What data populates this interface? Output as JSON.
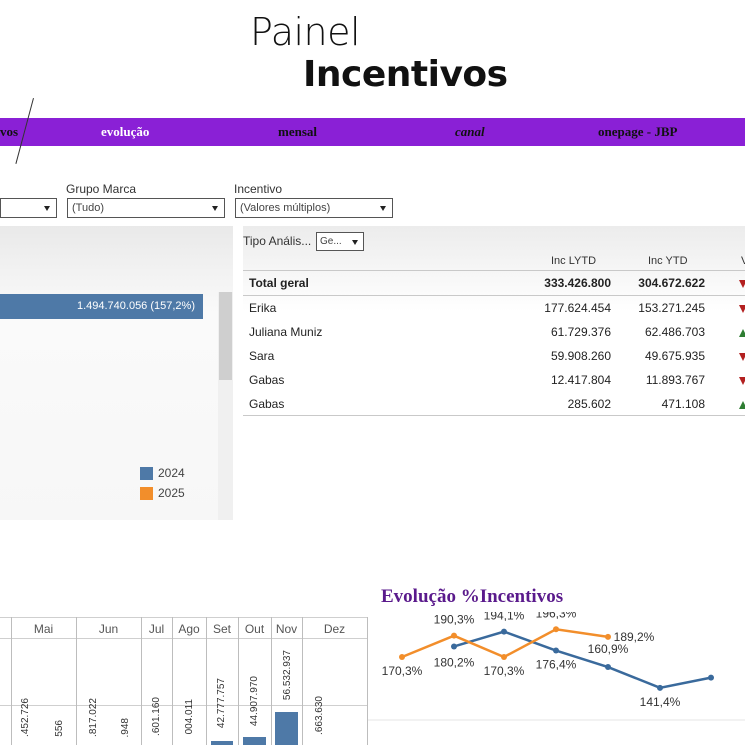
{
  "header": {
    "title_line1": "Painel",
    "title_line2": "Incentivos"
  },
  "nav": {
    "items": [
      {
        "label": "vos"
      },
      {
        "label": "evolução"
      },
      {
        "label": "mensal"
      },
      {
        "label": "canal"
      },
      {
        "label": "onepage - JBP"
      }
    ]
  },
  "filters": {
    "grupo_marca": {
      "label": "Grupo Marca",
      "value": "(Tudo)"
    },
    "incentivo": {
      "label": "Incentivo",
      "value": "(Valores múltiplos)"
    }
  },
  "left_panel": {
    "bar_label": "1.494.740.056 (157,2%)",
    "legend": [
      {
        "label": "2024",
        "color": "#4e79a7"
      },
      {
        "label": "2025",
        "color": "#f28e2b"
      }
    ]
  },
  "table": {
    "tipo_label": "Tipo Anális...",
    "tipo_value": "Ge...",
    "columns": [
      "Inc LYTD",
      "Inc YTD",
      "V"
    ],
    "total": {
      "name": "Total geral",
      "lytd": "333.426.800",
      "ytd": "304.672.622"
    },
    "rows": [
      {
        "name": "Erika",
        "lytd": "177.624.454",
        "ytd": "153.271.245",
        "trend": "down"
      },
      {
        "name": "Juliana Muniz",
        "lytd": "61.729.376",
        "ytd": "62.486.703",
        "trend": "up"
      },
      {
        "name": "Sara",
        "lytd": "59.908.260",
        "ytd": "49.675.935",
        "trend": "down"
      },
      {
        "name": "Gabas",
        "lytd": "12.417.804",
        "ytd": "11.893.767",
        "trend": "down"
      },
      {
        "name": "Gabas",
        "lytd": "285.602",
        "ytd": "471.108",
        "trend": "up"
      }
    ]
  },
  "monthly": {
    "months": [
      "Mai",
      "Jun",
      "Jul",
      "Ago",
      "Set",
      "Out",
      "Nov",
      "Dez"
    ],
    "values": [
      {
        "month": "Mai",
        "labels": [
          ".452.726",
          "556"
        ]
      },
      {
        "month": "Jun",
        "labels": [
          ".817.022",
          ".948"
        ]
      },
      {
        "month": "Jul",
        "labels": [
          ".601.160"
        ]
      },
      {
        "month": "Ago",
        "labels": [
          "004.011"
        ]
      },
      {
        "month": "Set",
        "labels": [
          "42.777.757"
        ]
      },
      {
        "month": "Out",
        "labels": [
          "44.907.970"
        ]
      },
      {
        "month": "Nov",
        "labels": [
          "56.532.937"
        ]
      },
      {
        "month": "Dez",
        "labels": [
          ".663.630"
        ]
      }
    ]
  },
  "evolucao": {
    "title": "Evolução %Incentivos",
    "chart_data": {
      "type": "line",
      "series": [
        {
          "name": "2024",
          "color": "#3a6a9c",
          "values": [
            null,
            180.2,
            194.1,
            176.4,
            160.9,
            141.4,
            151.0
          ],
          "labels": [
            "",
            "180,2%",
            "194,1%",
            "176,4%",
            "160,9%",
            "141,4%",
            ""
          ]
        },
        {
          "name": "2025",
          "color": "#f28e2b",
          "values": [
            170.3,
            190.3,
            170.3,
            196.3,
            189.2
          ],
          "labels": [
            "170,3%",
            "190,3%",
            "170,3%",
            "196,3%",
            "189,2%"
          ]
        }
      ]
    }
  }
}
